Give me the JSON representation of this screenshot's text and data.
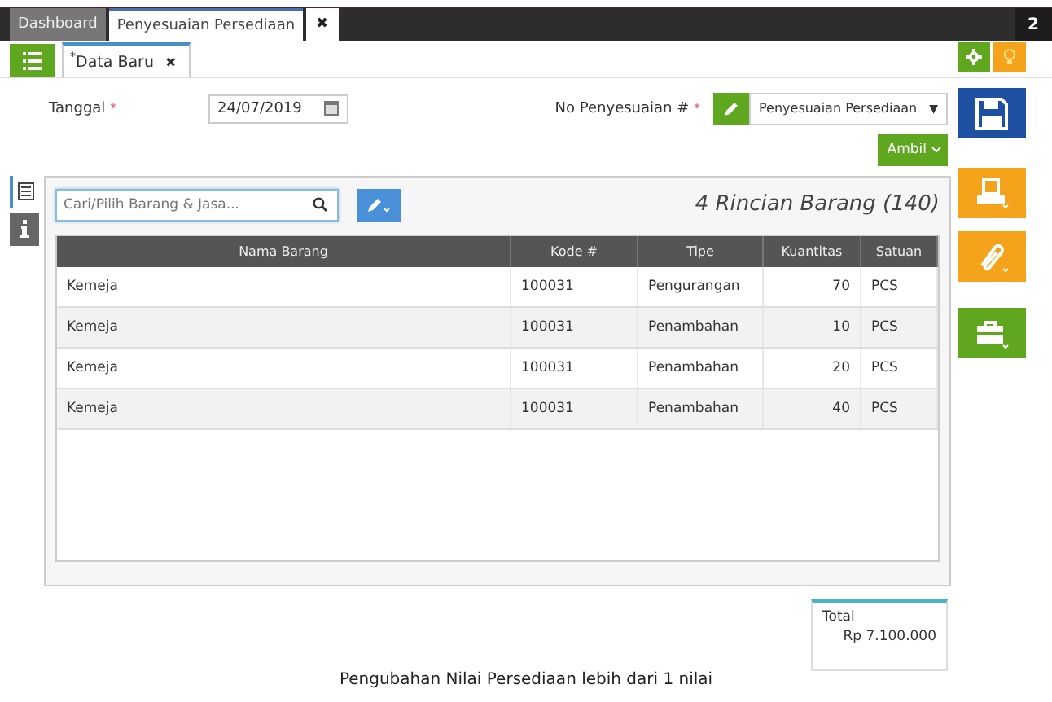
{
  "top_tabs": [
    {
      "label": "Dashboard",
      "selected": false
    },
    {
      "label": "Penyesuaian Persediaan",
      "selected": true
    }
  ],
  "top_close": "✖",
  "top_counter": "2",
  "doc_tabs": [
    {
      "label": "Data Baru",
      "modified_mark": "*",
      "close": "✖",
      "selected": true
    }
  ],
  "form": {
    "date_label": "Tanggal",
    "date_required": "*",
    "date_value": "24/07/2019",
    "number_label": "No Penyesuaian #",
    "number_required": "*",
    "number_value": "Penyesuaian Persediaan",
    "select_caret": "▼",
    "fetch_button": "Ambil"
  },
  "search": {
    "placeholder": "Cari/Pilih Barang & Jasa..."
  },
  "detail_title": "4 Rincian Barang (140)",
  "table": {
    "columns": [
      "Nama Barang",
      "Kode #",
      "Tipe",
      "Kuantitas",
      "Satuan"
    ],
    "rows": [
      [
        "Kemeja",
        "100031",
        "Pengurangan",
        "70",
        "PCS"
      ],
      [
        "Kemeja",
        "100031",
        "Penambahan",
        "10",
        "PCS"
      ],
      [
        "Kemeja",
        "100031",
        "Penambahan",
        "20",
        "PCS"
      ],
      [
        "Kemeja",
        "100031",
        "Penambahan",
        "40",
        "PCS"
      ]
    ]
  },
  "total": {
    "label": "Total",
    "value": "Rp 7.100.000"
  },
  "caption": "Pengubahan Nilai Persediaan lebih dari 1 nilai"
}
